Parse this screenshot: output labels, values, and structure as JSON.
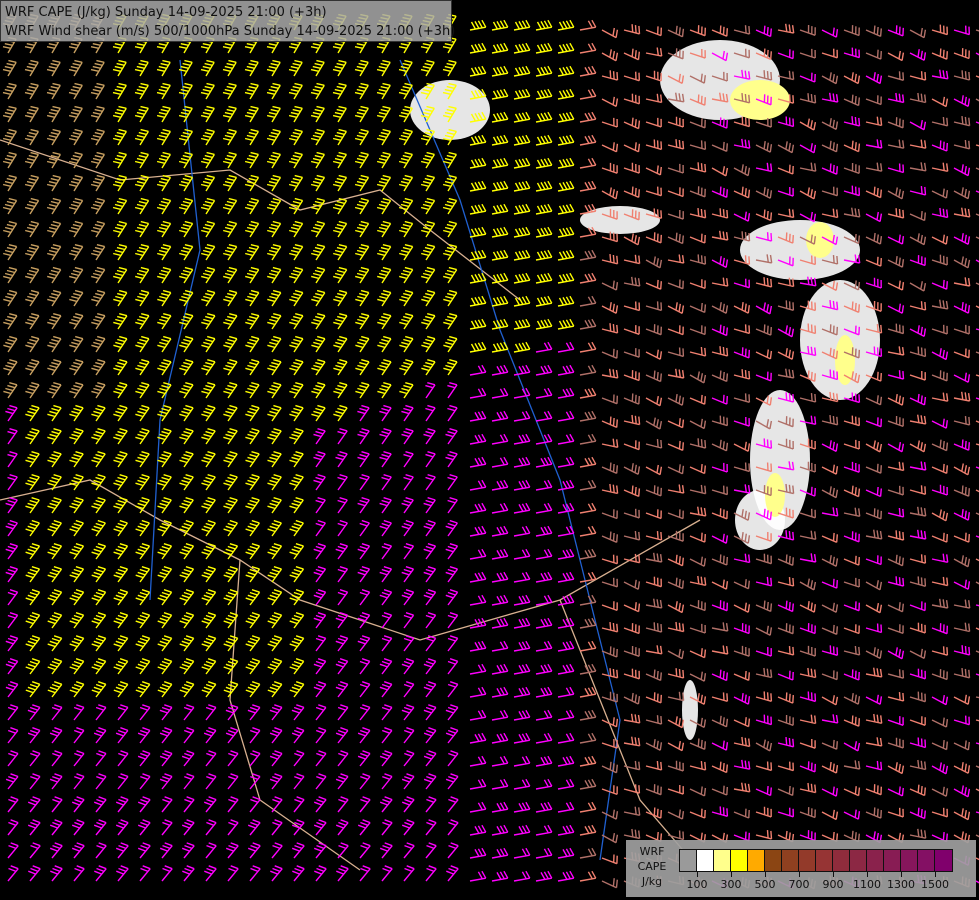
{
  "header": {
    "line1": "WRF CAPE (J/kg) Sunday 14-09-2025 21:00 (+3h)",
    "line2": "WRF Wind shear (m/s) 500/1000hPa Sunday 14-09-2025 21:00 (+3h)"
  },
  "legend": {
    "label_lines": [
      "WRF",
      "CAPE",
      "J/kg"
    ],
    "colors": [
      "#9a9a9a",
      "#ffffff",
      "#ffff8c",
      "#ffff00",
      "#ffaa00",
      "#8b4513",
      "#8f4020",
      "#933a2a",
      "#963434",
      "#8f2c3c",
      "#8c2844",
      "#8a224c",
      "#881c54",
      "#86165c",
      "#841064",
      "#80006c"
    ],
    "tick_labels": [
      "100",
      "300",
      "500",
      "700",
      "900",
      "1100",
      "1300",
      "1500"
    ]
  },
  "map": {
    "barb_colors": {
      "strong": "#ffff00",
      "tan": "#c8a060",
      "magenta": "#ff00ff",
      "salmon": "#f08070",
      "brown": "#b07068",
      "violet": "#c070e0"
    },
    "border_color": "#d8b090",
    "river_color": "#2060d0"
  }
}
